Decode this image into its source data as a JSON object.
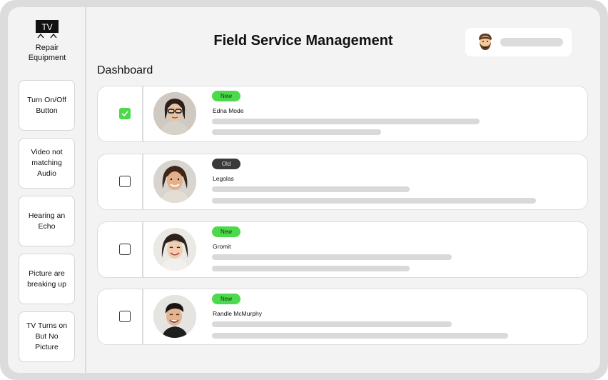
{
  "sidebar": {
    "logo_text": "TV",
    "logo_label_line1": "Repair",
    "logo_label_line2": "Equipment",
    "items": [
      {
        "label": "Turn On/Off Button"
      },
      {
        "label": "Video not matching Audio"
      },
      {
        "label": "Hearing an Echo"
      },
      {
        "label": "Picture are breaking up"
      },
      {
        "label": "TV Turns on But No Picture"
      }
    ]
  },
  "header": {
    "title": "Field Service Management"
  },
  "main": {
    "section_title": "Dashboard",
    "records": [
      {
        "name": "Edna Mode",
        "status": "New",
        "checked": true
      },
      {
        "name": "Legolas",
        "status": "Old",
        "checked": false
      },
      {
        "name": "Gromit",
        "status": "New",
        "checked": false
      },
      {
        "name": "Randle McMurphy",
        "status": "New",
        "checked": false
      }
    ]
  },
  "icons": {
    "logo": "tv-icon",
    "user": "bearded-man-avatar",
    "checkbox_checked": "check-icon"
  },
  "colors": {
    "accent_green": "#4cd94c",
    "badge_old": "#3a3a3a",
    "background": "#f3f3f3",
    "placeholder_bar": "#d9d9d9"
  }
}
